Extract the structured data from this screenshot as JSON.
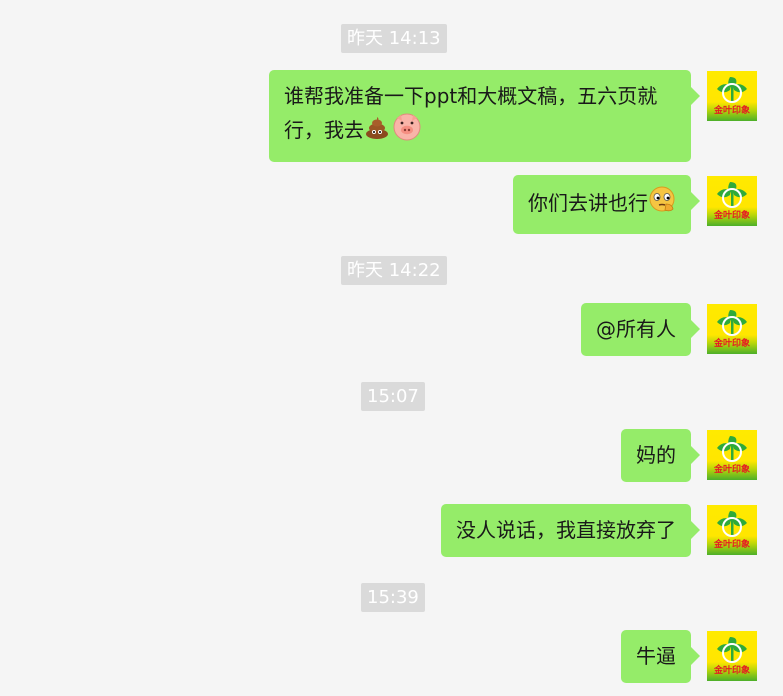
{
  "timestamps": [
    "昨天 14:13",
    "昨天 14:22",
    "15:07",
    "15:39"
  ],
  "messages": [
    {
      "text_line1": "谁帮我准备一下ppt和大概文稿，五六页就",
      "text_line2": "行，我去",
      "emojis": [
        "poop-emoji",
        "pig-emoji"
      ]
    },
    {
      "text": "你们去讲也行",
      "emojis": [
        "thinking-emoji"
      ]
    },
    {
      "text": "@所有人"
    },
    {
      "text": "妈的"
    },
    {
      "text": "没人说话，我直接放弃了"
    },
    {
      "text": "牛逼"
    }
  ],
  "avatar": {
    "label": "金叶印象",
    "colors": {
      "background": "#ffe600",
      "plant": "#2eaa3a",
      "text": "#e51c23"
    }
  },
  "colors": {
    "bubble": "#95ec69",
    "chat_background": "#f5f5f5",
    "timestamp_background": "#dadada"
  }
}
